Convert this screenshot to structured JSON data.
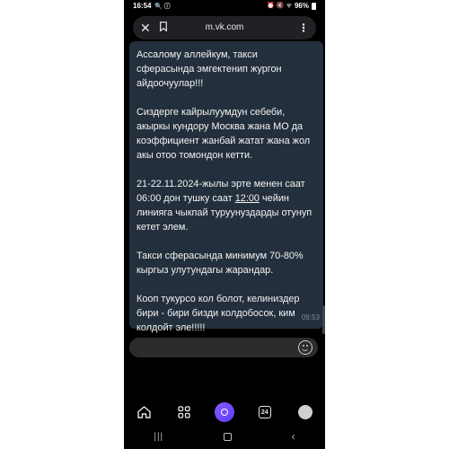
{
  "status_bar": {
    "time": "16:54",
    "left_icons": "🔍 ⓘ",
    "right_icons": "⏰ 🔇 ᯤ",
    "battery": "96%"
  },
  "browser": {
    "url": "m.vk.com"
  },
  "message": {
    "p1": "Ассалому аллейкум, такси сферасында эмгектенип жургон айдоочуулар!!!",
    "p2": "Сиздерге кайрылуумдун себеби, акыркы кундору Москва жана МО да коэффициент жанбай жатат жана жол акы отоо томондон кетти.",
    "p3_a": "21-22.11.2024-жылы эрте менен саат 06:00 дон тушку саат ",
    "p3_time": "12:00",
    "p3_b": " чейин линияга чыкпай туруунуздарды отунуп кетет элем.",
    "p4": "Такси сферасында минимум 70-80% кыргыз улутундагы жарандар.",
    "p5": "Кооп тукурсо кол болот, келиниздер бири - бири бизди колдобосок, ким колдойт эле!!!!!",
    "time": "09:53"
  },
  "bottom_nav": {
    "tabs_count": "24"
  },
  "colors": {
    "message_bg": "#242f3d",
    "accent": "#6a4bff"
  }
}
